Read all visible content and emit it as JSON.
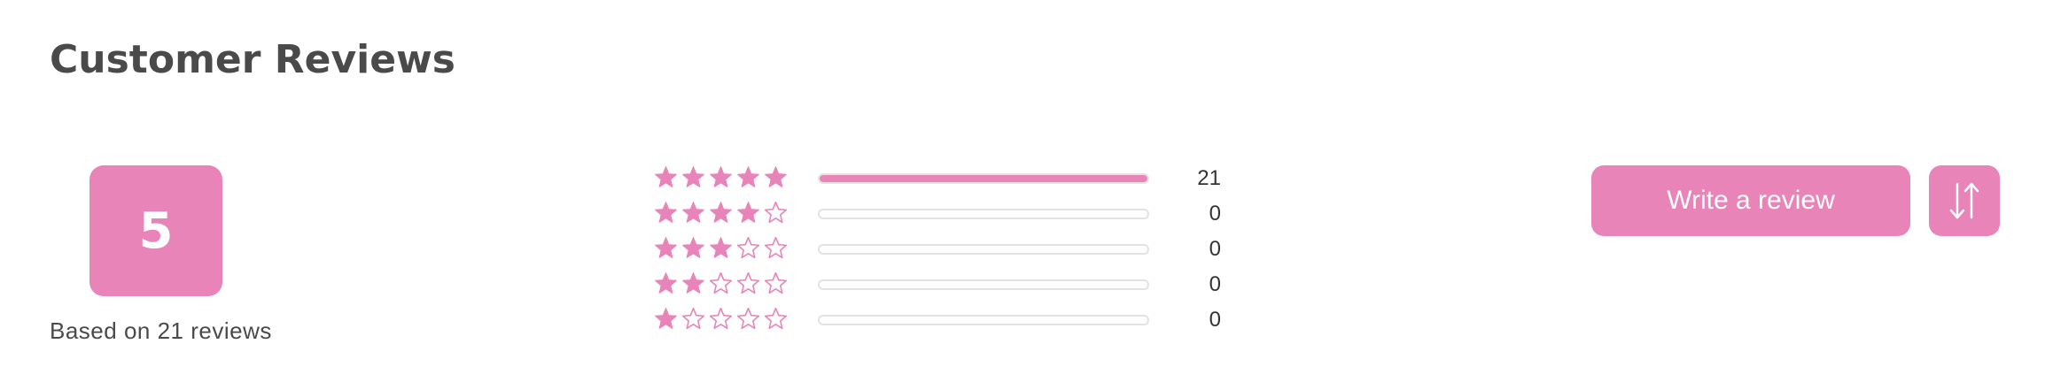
{
  "header": {
    "title": "Customer Reviews"
  },
  "summary": {
    "average_rating": "5",
    "based_on_text": "Based on 21 reviews"
  },
  "histogram": [
    {
      "stars": 5,
      "count": "21",
      "fraction": 1.0
    },
    {
      "stars": 4,
      "count": "0",
      "fraction": 0
    },
    {
      "stars": 3,
      "count": "0",
      "fraction": 0
    },
    {
      "stars": 2,
      "count": "0",
      "fraction": 0
    },
    {
      "stars": 1,
      "count": "0",
      "fraction": 0
    }
  ],
  "actions": {
    "write_review_label": "Write a review",
    "sort_icon": "sort-arrows-icon"
  },
  "colors": {
    "accent": "#e884b8",
    "text": "#4a4a4a",
    "track_border": "#e2e2e2"
  }
}
